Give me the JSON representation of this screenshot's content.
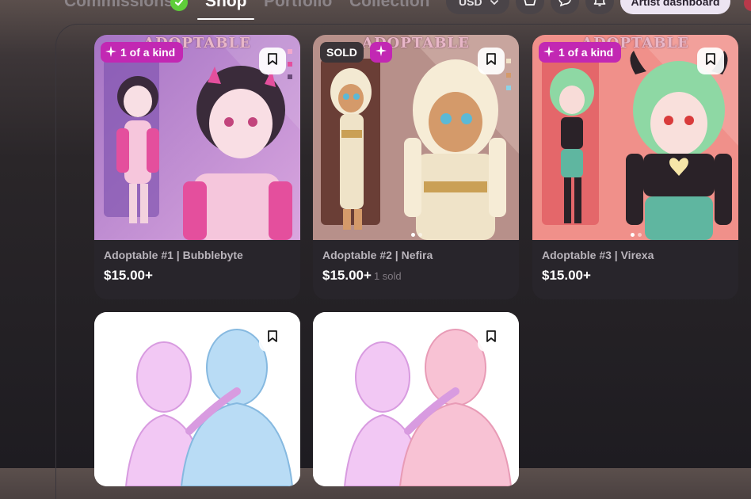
{
  "nav": {
    "tabs": [
      {
        "label": "Commissions"
      },
      {
        "label": "Shop"
      },
      {
        "label": "Portfolio"
      },
      {
        "label": "Collection"
      }
    ],
    "active_tab": "Shop",
    "currency": "USD",
    "dashboard_label": "Artist dashboard"
  },
  "icons": {
    "commissions_badge": "check-circle-icon",
    "currency_caret": "chevron-down-icon",
    "shop_button": "basket-icon",
    "messages_button": "chat-icon",
    "notifications_button": "bell-icon",
    "bookmark": "bookmark-icon",
    "kind_badge": "sparkle-icon"
  },
  "colors": {
    "accent_magenta": "#c228b3",
    "check_green": "#5fce3a",
    "dashboard_bg": "#ece4f2"
  },
  "listings": [
    {
      "title": "Adoptable #1 | Bubblebyte",
      "price": "$15.00+",
      "badge": "1 of a kind",
      "sheet_header": "ADOPTABLE"
    },
    {
      "title": "Adoptable #2 | Nefira",
      "price": "$15.00+",
      "sold_count": "1 sold",
      "sold_badge": "SOLD",
      "sheet_header": "ADOPTABLE"
    },
    {
      "title": "Adoptable #3 | Virexa",
      "price": "$15.00+",
      "badge": "1 of a kind",
      "sheet_header": "ADOPTABLE"
    },
    {
      "title": "",
      "price": ""
    },
    {
      "title": "",
      "price": ""
    }
  ]
}
